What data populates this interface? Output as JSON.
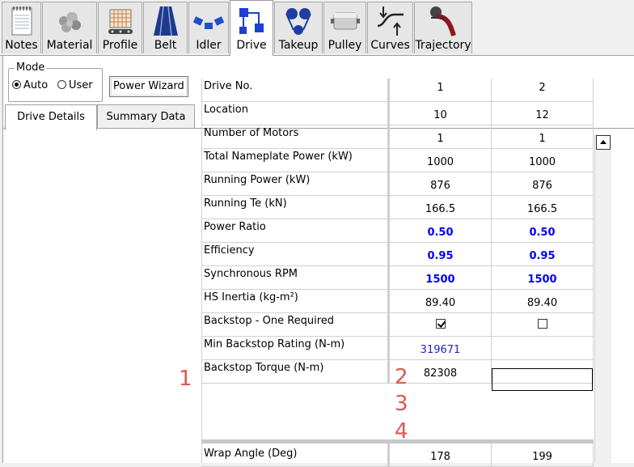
{
  "ribbon": {
    "tabs": [
      {
        "label": "Notes",
        "icon": "notes-icon"
      },
      {
        "label": "Material",
        "icon": "material-icon"
      },
      {
        "label": "Profile",
        "icon": "profile-icon"
      },
      {
        "label": "Belt",
        "icon": "belt-icon"
      },
      {
        "label": "Idler",
        "icon": "idler-icon"
      },
      {
        "label": "Drive",
        "icon": "drive-icon"
      },
      {
        "label": "Takeup",
        "icon": "takeup-icon"
      },
      {
        "label": "Pulley",
        "icon": "pulley-icon"
      },
      {
        "label": "Curves",
        "icon": "curves-icon"
      },
      {
        "label": "Trajectory",
        "icon": "trajectory-icon"
      }
    ],
    "active": "Drive"
  },
  "mode": {
    "legend": "Mode",
    "options": [
      "Auto",
      "User"
    ],
    "selected": "Auto"
  },
  "power_wizard_label": "Power Wizard",
  "subtabs": {
    "items": [
      "Drive Details",
      "Summary Data"
    ],
    "active": "Drive Details"
  },
  "grid": {
    "rows": [
      {
        "label": "Drive No.",
        "v1": "1",
        "v2": "2",
        "style": "normal"
      },
      {
        "label": "Location",
        "v1": "10",
        "v2": "12",
        "style": "normal"
      },
      {
        "label": "Number of Motors",
        "v1": "1",
        "v2": "1",
        "style": "normal"
      },
      {
        "label": "Total Nameplate Power (kW)",
        "v1": "1000",
        "v2": "1000",
        "style": "normal"
      },
      {
        "label": "Running Power (kW)",
        "v1": "876",
        "v2": "876",
        "style": "normal"
      },
      {
        "label": "Running Te (kN)",
        "v1": "166.5",
        "v2": "166.5",
        "style": "normal"
      },
      {
        "label": "Power Ratio",
        "v1": "0.50",
        "v2": "0.50",
        "style": "bold-blue"
      },
      {
        "label": "Efficiency",
        "v1": "0.95",
        "v2": "0.95",
        "style": "bold-blue"
      },
      {
        "label": "Synchronous RPM",
        "v1": "1500",
        "v2": "1500",
        "style": "bold-blue"
      },
      {
        "label": "HS Inertia (kg-m²)",
        "v1": "89.40",
        "v2": "89.40",
        "style": "normal"
      },
      {
        "label": "Backstop - One Required",
        "v1": true,
        "v2": false,
        "style": "checkbox"
      },
      {
        "label": "Min Backstop Rating (N-m)",
        "v1": "319671",
        "v2": "",
        "style": "blue"
      },
      {
        "label": "Backstop Torque (N-m)",
        "v1": "82308",
        "v2": "",
        "style": "normal"
      },
      {
        "label": "Wrap Angle (Deg)",
        "v1": "178",
        "v2": "199",
        "style": "normal"
      }
    ]
  },
  "annotations": [
    "1",
    "2",
    "3",
    "4"
  ],
  "colors": {
    "annotation": "#e05555",
    "value_blue": "#0000ff"
  }
}
